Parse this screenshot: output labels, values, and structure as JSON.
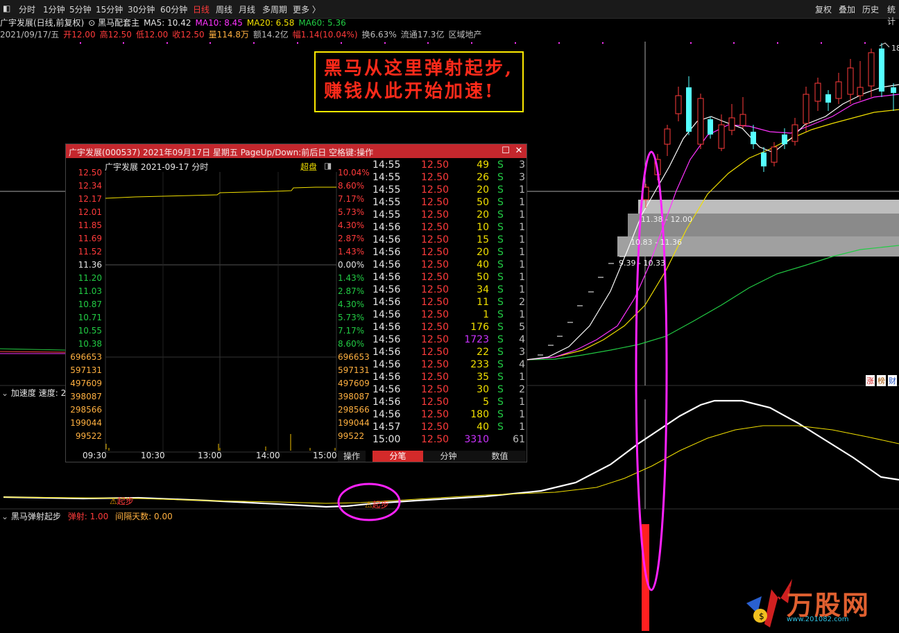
{
  "toolbar": {
    "periods": [
      "分时",
      "1分钟",
      "5分钟",
      "15分钟",
      "30分钟",
      "60分钟",
      "日线",
      "周线",
      "月线",
      "多周期",
      "更多 〉"
    ],
    "active_period": "日线",
    "right_items": [
      "复权",
      "叠加",
      "历史",
      "统计"
    ]
  },
  "info_line1": {
    "stock": "广宇发展(日线,前复权)",
    "indicator": "黑马配套主",
    "ma5": "MA5: 10.42",
    "ma10": "MA10: 8.45",
    "ma20": "MA20: 6.58",
    "ma60": "MA60: 5.36"
  },
  "info_line2": {
    "date": "2021/09/17/五",
    "open": "开12.00",
    "high": "高12.50",
    "low": "低12.00",
    "close": "收12.50",
    "vol": "量114.8万",
    "amount": "额14.2亿",
    "change": "幅1.14(10.04%)",
    "turnover": "换6.63%",
    "float": "流通17.3亿",
    "sector": "区域地产"
  },
  "annotation": {
    "line1": "黑马从这里弹射起步,",
    "line2": "赚钱从此开始加速!"
  },
  "price_marker": "18",
  "chips": {
    "band1": "11.38 - 12.00",
    "band2": "10.83 - 11.36",
    "band3": "9.39 - 10.33"
  },
  "right_badges": [
    "涨",
    "榜",
    "财"
  ],
  "panel_accel": {
    "title": "加速度",
    "subtitle": "速度: 2",
    "marker1": "起步",
    "marker2": "起步"
  },
  "panel_horse": {
    "title": "黑马弹射起步",
    "launch": "弹射: 1.00",
    "gap": "间隔天数: 0.00"
  },
  "popup": {
    "title": "广宇发展(000537) 2021年09月17日 星期五 PageUp/Down:前后日 空格键:操作",
    "subheader": "广宇发展  2021-09-17 分时",
    "super_label": "超盘",
    "left_prices": [
      "12.50",
      "12.34",
      "12.17",
      "12.01",
      "11.85",
      "11.69",
      "11.52",
      "11.36",
      "11.20",
      "11.03",
      "10.87",
      "10.71",
      "10.55",
      "10.38"
    ],
    "right_pcts": [
      "10.04%",
      "8.60%",
      "7.17%",
      "5.73%",
      "4.30%",
      "2.87%",
      "1.43%",
      "0.00%",
      "1.43%",
      "2.87%",
      "4.30%",
      "5.73%",
      "7.17%",
      "8.60%"
    ],
    "vol_labels": [
      "696653",
      "597131",
      "497609",
      "398087",
      "298566",
      "199044",
      "99522"
    ],
    "time_labels": [
      "09:30",
      "10:30",
      "13:00",
      "14:00",
      "15:00"
    ],
    "op_button": "操作",
    "ticks": [
      {
        "t": "14:55",
        "p": "12.50",
        "v": "49",
        "s": "S",
        "n": "3"
      },
      {
        "t": "14:55",
        "p": "12.50",
        "v": "26",
        "s": "S",
        "n": "3"
      },
      {
        "t": "14:55",
        "p": "12.50",
        "v": "20",
        "s": "S",
        "n": "1"
      },
      {
        "t": "14:55",
        "p": "12.50",
        "v": "50",
        "s": "S",
        "n": "1"
      },
      {
        "t": "14:55",
        "p": "12.50",
        "v": "20",
        "s": "S",
        "n": "1"
      },
      {
        "t": "14:56",
        "p": "12.50",
        "v": "10",
        "s": "S",
        "n": "1"
      },
      {
        "t": "14:56",
        "p": "12.50",
        "v": "15",
        "s": "S",
        "n": "1"
      },
      {
        "t": "14:56",
        "p": "12.50",
        "v": "20",
        "s": "S",
        "n": "1"
      },
      {
        "t": "14:56",
        "p": "12.50",
        "v": "40",
        "s": "S",
        "n": "1"
      },
      {
        "t": "14:56",
        "p": "12.50",
        "v": "50",
        "s": "S",
        "n": "1"
      },
      {
        "t": "14:56",
        "p": "12.50",
        "v": "34",
        "s": "S",
        "n": "1"
      },
      {
        "t": "14:56",
        "p": "12.50",
        "v": "11",
        "s": "S",
        "n": "2"
      },
      {
        "t": "14:56",
        "p": "12.50",
        "v": "1",
        "s": "S",
        "n": "1"
      },
      {
        "t": "14:56",
        "p": "12.50",
        "v": "176",
        "s": "S",
        "n": "5"
      },
      {
        "t": "14:56",
        "p": "12.50",
        "v": "1723",
        "s": "S",
        "n": "4"
      },
      {
        "t": "14:56",
        "p": "12.50",
        "v": "22",
        "s": "S",
        "n": "3"
      },
      {
        "t": "14:56",
        "p": "12.50",
        "v": "233",
        "s": "S",
        "n": "4"
      },
      {
        "t": "14:56",
        "p": "12.50",
        "v": "35",
        "s": "S",
        "n": "1"
      },
      {
        "t": "14:56",
        "p": "12.50",
        "v": "30",
        "s": "S",
        "n": "2"
      },
      {
        "t": "14:56",
        "p": "12.50",
        "v": "5",
        "s": "S",
        "n": "1"
      },
      {
        "t": "14:56",
        "p": "12.50",
        "v": "180",
        "s": "S",
        "n": "1"
      },
      {
        "t": "14:57",
        "p": "12.50",
        "v": "40",
        "s": "S",
        "n": "1"
      },
      {
        "t": "15:00",
        "p": "12.50",
        "v": "3310",
        "s": "",
        "n": "61"
      }
    ],
    "tabs": [
      "分笔",
      "分钟",
      "数值"
    ]
  },
  "logo": {
    "name": "万股网",
    "url": "www.201082.com"
  }
}
